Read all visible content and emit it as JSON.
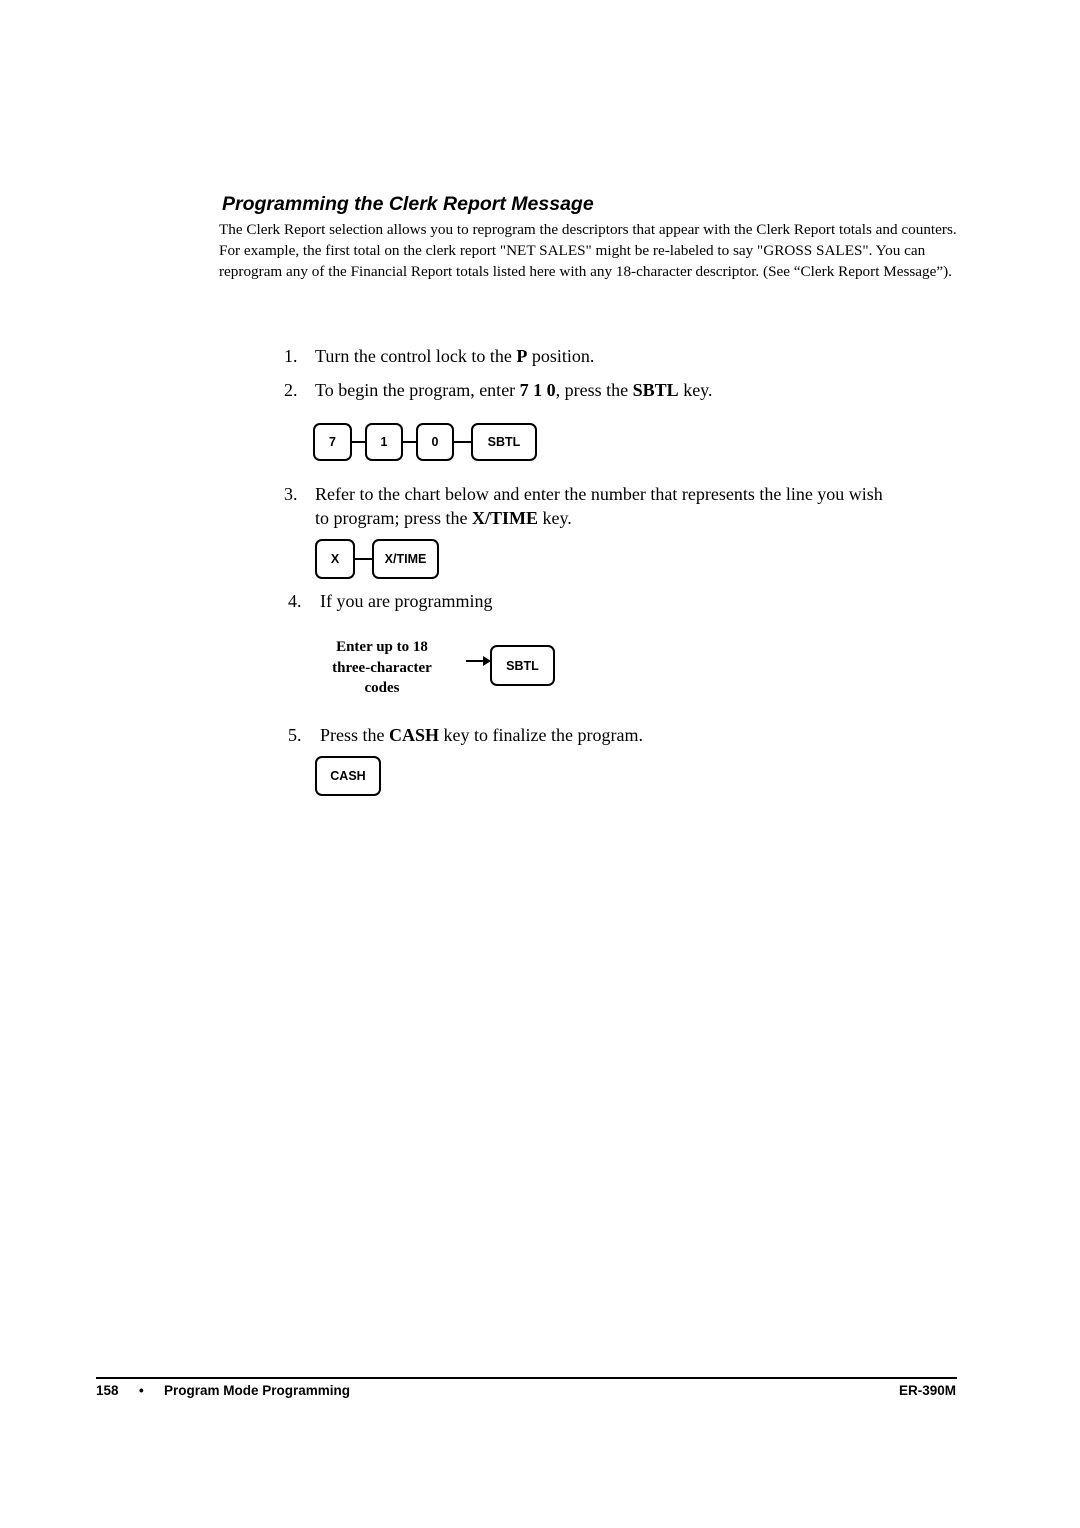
{
  "section": {
    "title": "Programming the Clerk Report Message",
    "intro": "The Clerk Report selection allows you to reprogram the descriptors that appear with the Clerk Report totals and counters.   For example, the first total on the clerk report \"NET SALES\" might be re-labeled to say \"GROSS SALES\".   You can reprogram any of the Financial Report totals listed here with any 18-character descriptor. (See “Clerk Report Message”)."
  },
  "steps": [
    {
      "num": "1.",
      "pre": "Turn the control lock to the ",
      "bold": "P",
      "post": " position."
    },
    {
      "num": "2.",
      "pre": "To begin the program, enter ",
      "bold": "7 1 0",
      "mid": ", press the ",
      "bold2": "SBTL",
      "post": " key."
    },
    {
      "num": "3.",
      "line1": "Refer to the chart below and enter the number that represents the line you wish",
      "pre": "to program; press the ",
      "bold": "X/TIME",
      "post": " key."
    },
    {
      "num": "4.",
      "text": "If you are programming"
    },
    {
      "num": "5.",
      "pre": "Press the ",
      "bold": "CASH",
      "post": " key to finalize the program."
    }
  ],
  "sequences": {
    "step2_keys": [
      "7",
      "1",
      "0",
      "SBTL"
    ],
    "step3_keys": [
      "X",
      "X/TIME"
    ],
    "step4_label": [
      "Enter up to 18",
      "three-character",
      "codes"
    ],
    "step4_key": "SBTL",
    "step5_key": "CASH"
  },
  "footer": {
    "page_number": "158",
    "bullet": "•",
    "section": "Program Mode Programming",
    "model": "ER-390M"
  }
}
